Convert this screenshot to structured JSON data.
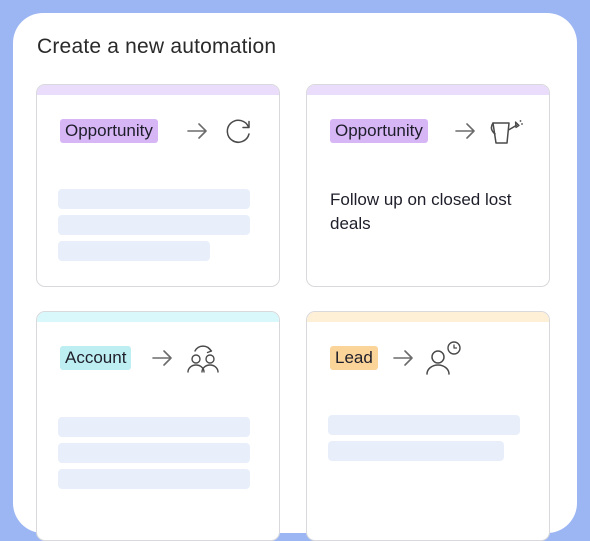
{
  "page": {
    "title": "Create a new automation"
  },
  "cards": [
    {
      "tag": "Opportunity",
      "tag_color": "#d7b6f6",
      "strip_color": "#eadcfb",
      "icon": "refresh-icon"
    },
    {
      "tag": "Opportunity",
      "tag_color": "#d7b6f6",
      "strip_color": "#eadcfb",
      "icon": "watering-can-icon",
      "description": "Follow up on closed lost deals"
    },
    {
      "tag": "Account",
      "tag_color": "#bdeef2",
      "strip_color": "#d9f8fb",
      "icon": "users-sync-icon"
    },
    {
      "tag": "Lead",
      "tag_color": "#fbd49a",
      "strip_color": "#fdf0d6",
      "icon": "user-clock-icon"
    }
  ],
  "colors": {
    "background": "#9cb6f4",
    "panel": "#ffffff",
    "placeholder_bar": "#e9effa",
    "card_border": "#d9d9dd"
  }
}
